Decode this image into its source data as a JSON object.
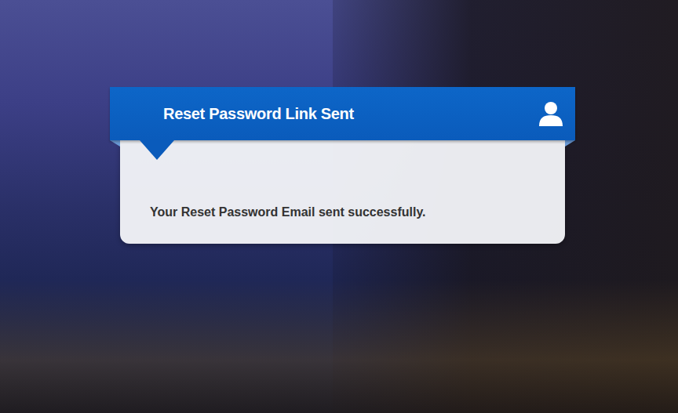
{
  "dialog": {
    "title": "Reset Password Link Sent",
    "message": "Your Reset Password Email sent successfully."
  }
}
